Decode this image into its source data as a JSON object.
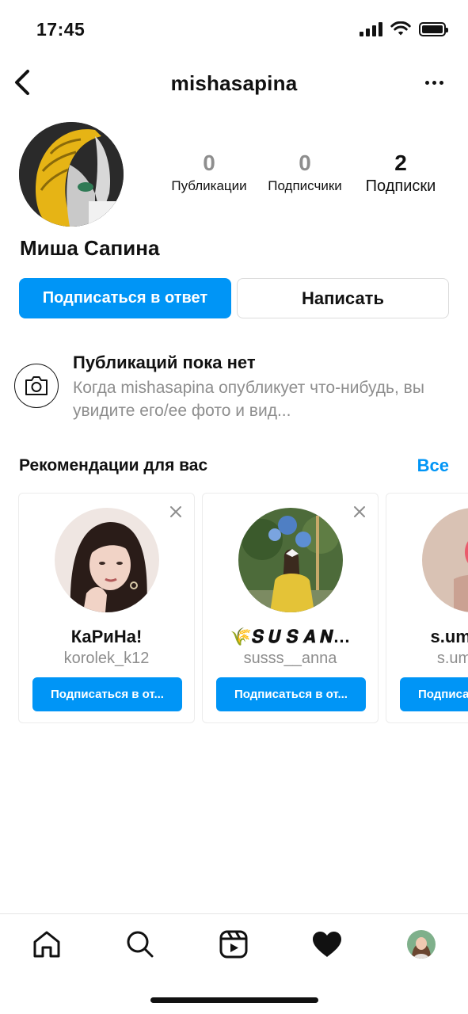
{
  "status_bar": {
    "time": "17:45"
  },
  "header": {
    "username": "mishasapina"
  },
  "profile": {
    "stats": [
      {
        "value": "0",
        "label": "Публикации"
      },
      {
        "value": "0",
        "label": "Подписчики"
      },
      {
        "value": "2",
        "label": "Подписки"
      }
    ],
    "full_name": "Миша Сапина",
    "follow_back_label": "Подписаться в ответ",
    "message_label": "Написать"
  },
  "no_posts": {
    "title": "Публикаций пока нет",
    "text": "Когда mishasapina опубликует что-нибудь, вы увидите его/ее фото и вид..."
  },
  "recommendations": {
    "title": "Рекомендации для вас",
    "see_all": "Все",
    "cards": [
      {
        "name": "КаРиНа!",
        "username": "korolek_k12",
        "button": "Подписаться в от..."
      },
      {
        "name": "🌾𝑺 𝑼 𝑺 𝑨 𝑵…",
        "username": "susss__anna",
        "button": "Подписаться в от..."
      },
      {
        "name": "s.umarova",
        "username": "s.umarova",
        "button": "Подписаться в от..."
      }
    ]
  },
  "tab_bar": {
    "icons": [
      "home-icon",
      "search-icon",
      "reels-icon",
      "heart-icon",
      "profile-avatar"
    ]
  },
  "colors": {
    "accent": "#0095f6",
    "muted_text": "#8e8e8e",
    "border": "#dbdbdb"
  }
}
